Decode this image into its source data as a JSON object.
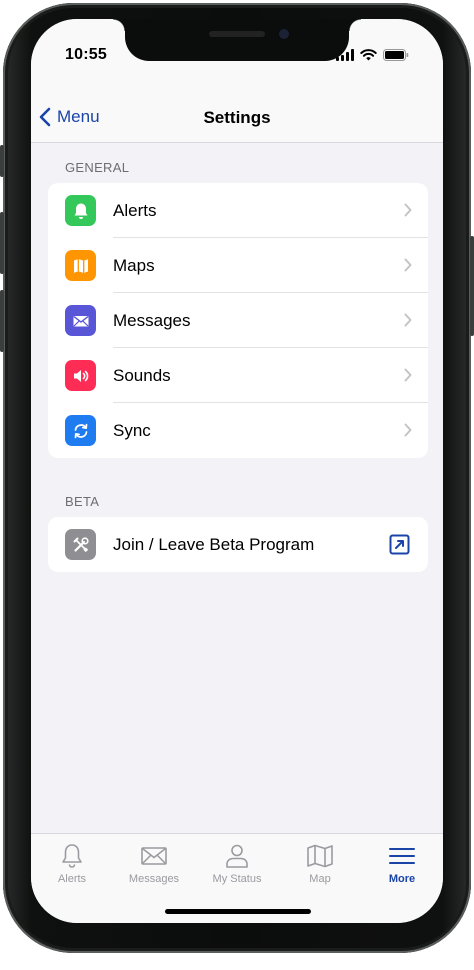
{
  "status_bar": {
    "time": "10:55"
  },
  "nav": {
    "back_label": "Menu",
    "title": "Settings"
  },
  "sections": {
    "general": {
      "header": "GENERAL",
      "items": [
        {
          "label": "Alerts",
          "icon": "bell-icon",
          "color": "#34c759"
        },
        {
          "label": "Maps",
          "icon": "map-icon",
          "color": "#ff9500"
        },
        {
          "label": "Messages",
          "icon": "envelope-icon",
          "color": "#5856d6"
        },
        {
          "label": "Sounds",
          "icon": "speaker-icon",
          "color": "#ff2d55"
        },
        {
          "label": "Sync",
          "icon": "sync-icon",
          "color": "#1f7cf0"
        }
      ]
    },
    "beta": {
      "header": "BETA",
      "items": [
        {
          "label": "Join / Leave Beta Program",
          "icon": "tools-icon",
          "color": "#8e8e93",
          "trailing_icon": "external-link-icon"
        }
      ]
    }
  },
  "tab_bar": {
    "active": "More",
    "tabs": [
      {
        "label": "Alerts",
        "icon": "bell-outline-icon"
      },
      {
        "label": "Messages",
        "icon": "envelope-outline-icon"
      },
      {
        "label": "My Status",
        "icon": "person-outline-icon"
      },
      {
        "label": "Map",
        "icon": "map-outline-icon"
      },
      {
        "label": "More",
        "icon": "hamburger-menu-icon"
      }
    ]
  },
  "colors": {
    "accent": "#1a44a8",
    "background": "#f2f2f7",
    "tab_inactive": "#9a9aa0"
  }
}
